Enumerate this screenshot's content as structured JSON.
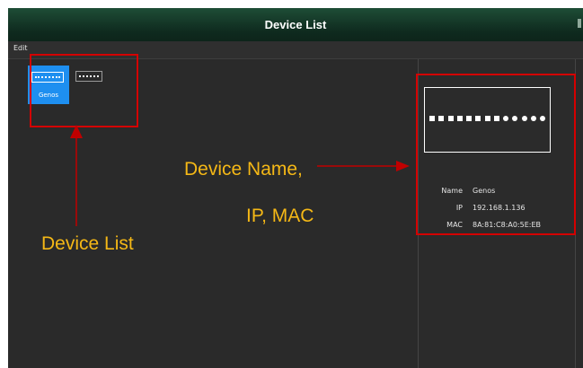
{
  "window": {
    "title": "Device List"
  },
  "menu": {
    "items": [
      "Edit"
    ]
  },
  "devices": [
    {
      "label": "Genos",
      "selected": true
    },
    {
      "label": "",
      "selected": false
    }
  ],
  "details": {
    "name_label": "Name",
    "name_value": "Genos",
    "ip_label": "IP",
    "ip_value": "192.168.1.136",
    "mac_label": "MAC",
    "mac_value": "8A:81:C8:A0:5E:EB"
  },
  "annotations": {
    "device_list": "Device List",
    "device_info_line1": "Device Name,",
    "device_info_line2": "IP, MAC"
  },
  "colors": {
    "titlebar": "#124030",
    "selected_tile": "#1e8ff0",
    "annotation_text": "#f5b816",
    "highlight": "#d40000"
  }
}
